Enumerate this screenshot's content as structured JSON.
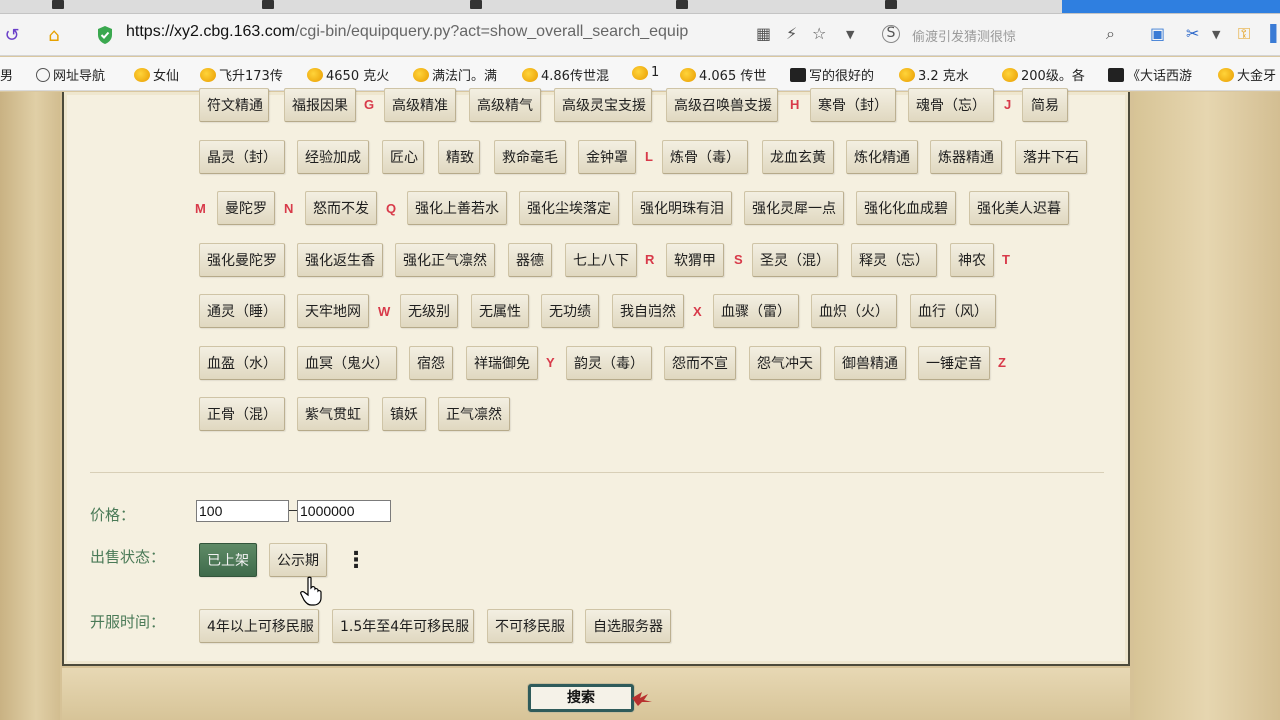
{
  "browser": {
    "url_host": "https://xy2.cbg.163.com",
    "url_path": "/cgi-bin/equipquery.py?act=show_overall_search_equip",
    "search_placeholder": "偷渡引发猜测很惊"
  },
  "bookmarks": [
    {
      "label": "男",
      "icon": "folder-icon"
    },
    {
      "label": "网址导航",
      "icon": "globe-icon"
    },
    {
      "label": "女仙",
      "icon": "bookmark-icon"
    },
    {
      "label": "飞升173传",
      "icon": "bookmark-icon"
    },
    {
      "label": "4650 克火",
      "icon": "bookmark-icon"
    },
    {
      "label": "满法门。满",
      "icon": "bookmark-icon"
    },
    {
      "label": "4.86传世混",
      "icon": "bookmark-icon"
    },
    {
      "label": "1",
      "icon": "bookmark-icon"
    },
    {
      "label": "4.065 传世",
      "icon": "bookmark-icon"
    },
    {
      "label": "写的很好的",
      "icon": "dark-bookmark-icon"
    },
    {
      "label": "3.2   克水",
      "icon": "bookmark-icon"
    },
    {
      "label": "200级。各",
      "icon": "bookmark-icon"
    },
    {
      "label": "《大话西游",
      "icon": "dark-bookmark-icon"
    },
    {
      "label": "大金牙",
      "icon": "bookmark-icon"
    }
  ],
  "letters": [
    "G",
    "H",
    "J",
    "L",
    "M",
    "N",
    "Q",
    "R",
    "S",
    "T",
    "W",
    "X",
    "Y",
    "Z"
  ],
  "skills": [
    "符文精通",
    "福报因果",
    "高级精准",
    "高级精气",
    "高级灵宝支援",
    "高级召唤兽支援",
    "寒骨（封）",
    "魂骨（忘）",
    "简易",
    "晶灵（封）",
    "经验加成",
    "匠心",
    "精致",
    "救命毫毛",
    "金钟罩",
    "炼骨（毒）",
    "龙血玄黄",
    "炼化精通",
    "炼器精通",
    "落井下石",
    "曼陀罗",
    "怒而不发",
    "强化上善若水",
    "强化尘埃落定",
    "强化明珠有泪",
    "强化灵犀一点",
    "强化化血成碧",
    "强化美人迟暮",
    "强化曼陀罗",
    "强化返生香",
    "强化正气凛然",
    "器德",
    "七上八下",
    "软猬甲",
    "圣灵（混）",
    "释灵（忘）",
    "神农",
    "通灵（睡）",
    "天牢地网",
    "无级别",
    "无属性",
    "无功绩",
    "我自岿然",
    "血骤（雷）",
    "血炽（火）",
    "血行（风）",
    "血盈（水）",
    "血冥（鬼火）",
    "宿怨",
    "祥瑞御免",
    "韵灵（毒）",
    "怨而不宣",
    "怨气冲天",
    "御兽精通",
    "一锤定音",
    "正骨（混）",
    "紫气贯虹",
    "镇妖",
    "正气凛然"
  ],
  "filters": {
    "price_label": "价格：",
    "price_min": "100",
    "price_max": "1000000",
    "status_label": "出售状态：",
    "status_options": [
      "已上架",
      "公示期"
    ],
    "status_selected": "已上架",
    "more_label": "⋮",
    "server_label": "开服时间：",
    "server_options": [
      "4年以上可移民服",
      "1.5年至4年可移民服",
      "不可移民服",
      "自选服务器"
    ]
  },
  "search_button": "搜索"
}
